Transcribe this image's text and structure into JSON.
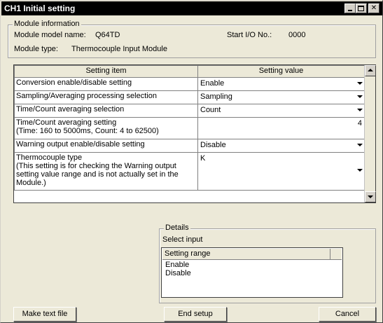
{
  "window": {
    "title": "CH1 Initial setting"
  },
  "module_info": {
    "legend": "Module information",
    "model_label": "Module model name:",
    "model_value": "Q64TD",
    "start_io_label": "Start I/O No.:",
    "start_io_value": "0000",
    "type_label": "Module type:",
    "type_value": "Thermocouple Input Module"
  },
  "grid": {
    "headers": [
      "Setting item",
      "Setting value"
    ],
    "rows": [
      {
        "item": "Conversion enable/disable setting",
        "value": "Enable"
      },
      {
        "item": "Sampling/Averaging processing selection",
        "value": "Sampling"
      },
      {
        "item": "Time/Count averaging selection",
        "value": "Count"
      },
      {
        "item": "Time/Count averaging setting\n(Time: 160 to 5000ms, Count: 4 to 62500)",
        "value": "4"
      },
      {
        "item": "Warning output enable/disable setting",
        "value": "Disable"
      },
      {
        "item": "Thermocouple type\n(This setting is for checking the Warning output\nsetting value range and is not actually set in the\nModule.)",
        "value": "K"
      }
    ]
  },
  "details": {
    "legend": "Details",
    "prompt": "Select input",
    "list_header": "Setting range",
    "options": [
      "Enable",
      "Disable"
    ]
  },
  "buttons": {
    "make_text_file": "Make text file",
    "end_setup": "End setup",
    "cancel": "Cancel"
  }
}
